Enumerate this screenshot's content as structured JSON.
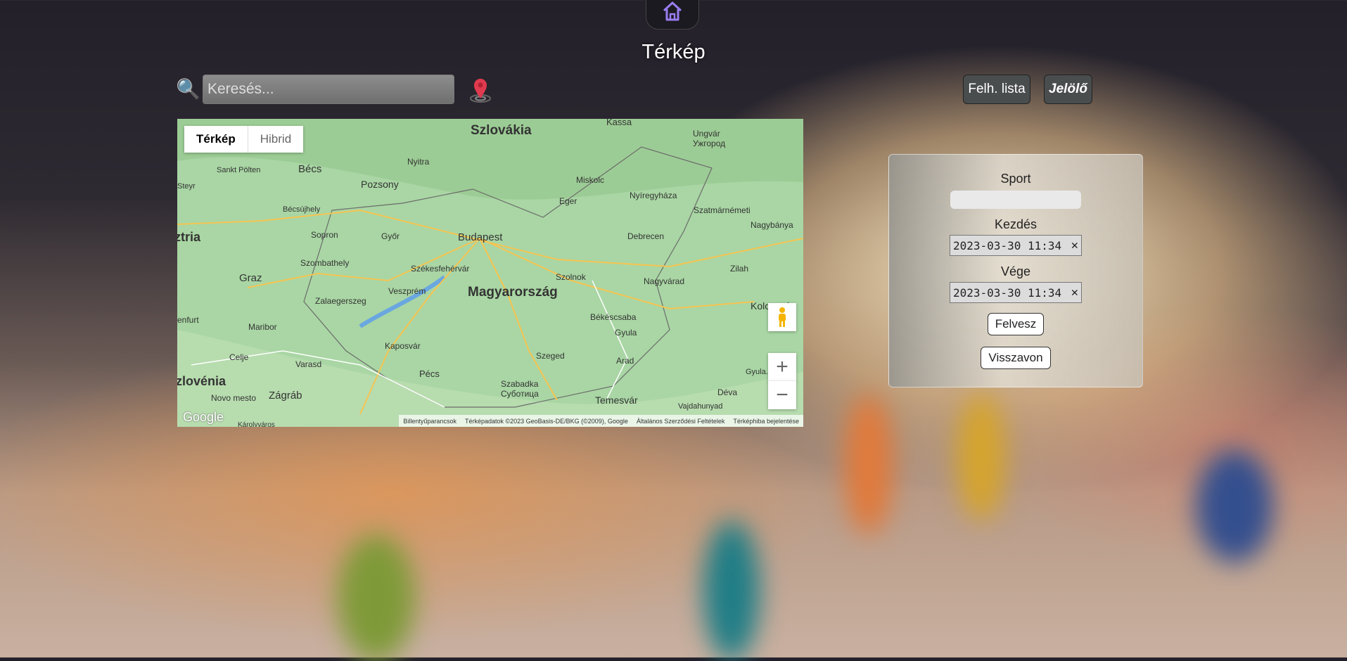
{
  "header": {
    "title": "Térkép"
  },
  "search": {
    "placeholder": "Keresés..."
  },
  "toolbar": {
    "user_list_label": "Felh. lista",
    "marker_label": "Jelölő"
  },
  "map": {
    "tabs": [
      {
        "label": "Térkép",
        "active": true
      },
      {
        "label": "Hibrid",
        "active": false
      }
    ],
    "zoom_in": "+",
    "zoom_out": "−",
    "logo": "Google",
    "labels": [
      {
        "text": "Szlovákia",
        "bold": true
      },
      {
        "text": "Magyarország",
        "bold": true
      },
      {
        "text": "Budapest"
      },
      {
        "text": "Bécs"
      },
      {
        "text": "Pozsony"
      },
      {
        "text": "Kassa"
      },
      {
        "text": "Ungvár Ужгород"
      },
      {
        "text": "Nyitra"
      },
      {
        "text": "Miskolc"
      },
      {
        "text": "Eger"
      },
      {
        "text": "Nyíregyháza"
      },
      {
        "text": "Szatmárnémeti"
      },
      {
        "text": "Nagybánya"
      },
      {
        "text": "Debrecen"
      },
      {
        "text": "Győr"
      },
      {
        "text": "Sopron"
      },
      {
        "text": "Szombathely"
      },
      {
        "text": "Székesfehérvár"
      },
      {
        "text": "Szolnok"
      },
      {
        "text": "Nagyvárad"
      },
      {
        "text": "Zilah"
      },
      {
        "text": "Graz"
      },
      {
        "text": "Zalaegerszeg"
      },
      {
        "text": "Veszprém"
      },
      {
        "text": "Maribor"
      },
      {
        "text": "Kaposvár"
      },
      {
        "text": "Békéscsaba"
      },
      {
        "text": "Gyula"
      },
      {
        "text": "Szeged"
      },
      {
        "text": "Arad"
      },
      {
        "text": "Pécs"
      },
      {
        "text": "Szabadka Суботица"
      },
      {
        "text": "Temesvár"
      },
      {
        "text": "Déva"
      },
      {
        "text": "Vajdahunyad"
      },
      {
        "text": "Zágráb"
      },
      {
        "text": "Novo mesto"
      },
      {
        "text": "Celje"
      },
      {
        "text": "Varasd"
      },
      {
        "text": "Sankt Pölten"
      },
      {
        "text": "Bécsújhely"
      },
      {
        "text": "Kolozsvár"
      },
      {
        "text": "Gyula..."
      },
      {
        "text": "ztria",
        "bold": true
      },
      {
        "text": "zlovénia",
        "bold": true
      },
      {
        "text": "enfurt"
      },
      {
        "text": "Steyr"
      },
      {
        "text": "Károlyváros"
      }
    ],
    "attribution": [
      "Billentyűparancsok",
      "Térképadatok ©2023 GeoBasis-DE/BKG (©2009), Google",
      "Általános Szerződési Feltételek",
      "Térképhiba bejelentése"
    ]
  },
  "form": {
    "sport_label": "Sport",
    "sport_value": "",
    "start_label": "Kezdés",
    "start_value": "2023-03-30 11:34",
    "end_label": "Vége",
    "end_value": "2023-03-30 11:34",
    "clear_glyph": "✕",
    "add_label": "Felvesz",
    "undo_label": "Visszavon"
  },
  "colors": {
    "map_land": "#a9d6a4",
    "panel_bg": "#d8d4cc",
    "dark_button": "#4a4d4e"
  }
}
